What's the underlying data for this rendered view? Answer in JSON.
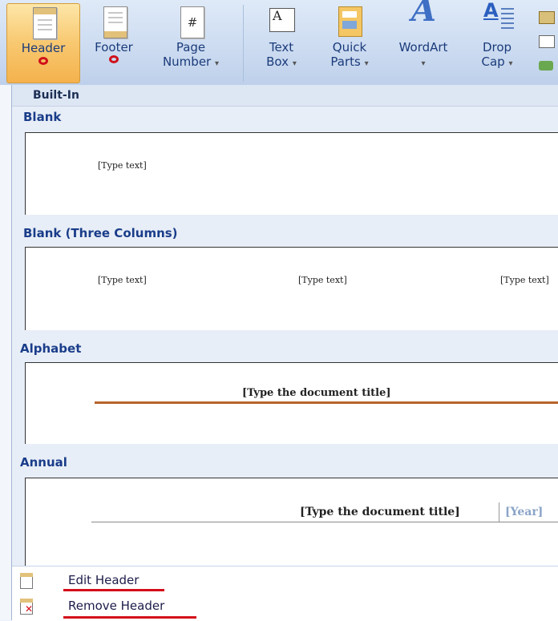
{
  "ribbon": {
    "buttons": [
      {
        "id": "header",
        "line1": "Header",
        "icon": "header-page-icon"
      },
      {
        "id": "footer",
        "line1": "Footer",
        "icon": "footer-page-icon"
      },
      {
        "id": "page_number",
        "line1": "Page",
        "line2": "Number",
        "icon": "page-number-icon"
      },
      {
        "id": "text_box",
        "line1": "Text",
        "line2": "Box",
        "icon": "text-box-icon"
      },
      {
        "id": "quick_parts",
        "line1": "Quick",
        "line2": "Parts",
        "icon": "quick-parts-icon"
      },
      {
        "id": "wordart",
        "line1": "WordArt",
        "icon": "wordart-icon"
      },
      {
        "id": "drop_cap",
        "line1": "Drop",
        "line2": "Cap",
        "icon": "drop-cap-icon"
      }
    ],
    "page_number_glyph": "#",
    "text_box_glyph": "A",
    "wordart_glyph": "A",
    "drop_cap_glyph": "A"
  },
  "menu": {
    "builtin_label": "Built-In",
    "sections": [
      {
        "title": "Blank",
        "placeholders": [
          "[Type text]"
        ]
      },
      {
        "title": "Blank (Three Columns)",
        "placeholders": [
          "[Type text]",
          "[Type text]",
          "[Type text]"
        ]
      },
      {
        "title": "Alphabet",
        "placeholders": [
          "[Type the document title]"
        ]
      },
      {
        "title": "Annual",
        "placeholders": [
          "[Type the document title]",
          "[Year]"
        ]
      }
    ],
    "commands": [
      {
        "label": "Edit Header",
        "icon": "edit-header-icon"
      },
      {
        "label": "Remove Header",
        "icon": "remove-header-icon"
      }
    ]
  },
  "colors": {
    "ribbon_text": "#1b3b7a",
    "section_title": "#1a3d8a",
    "annotation_red": "#d40e1a",
    "alphabet_rule": "#b8632c",
    "year_color": "#8aa4c8"
  }
}
